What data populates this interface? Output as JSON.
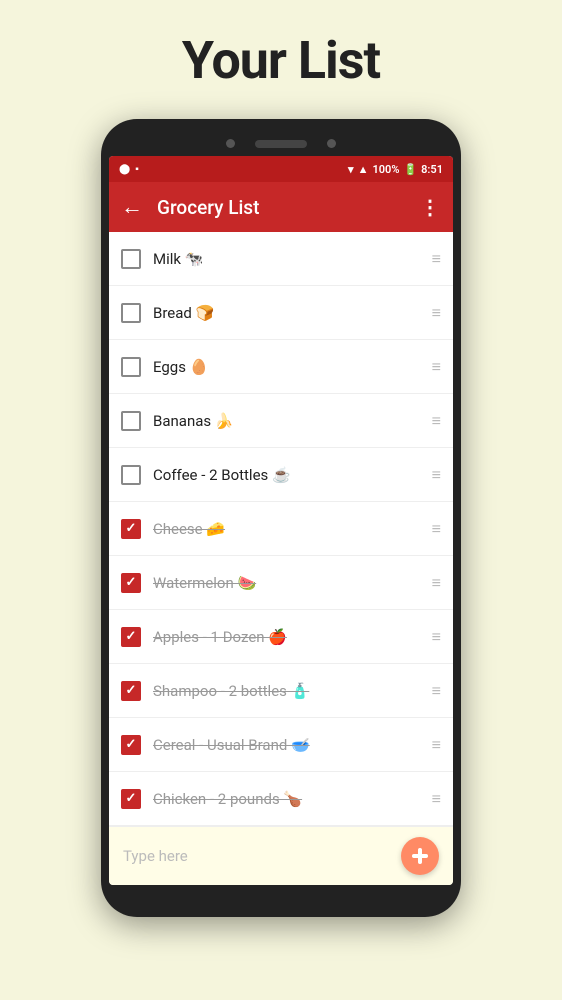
{
  "page": {
    "title": "Your List"
  },
  "statusBar": {
    "battery": "100%",
    "time": "8:51"
  },
  "appBar": {
    "title": "Grocery List",
    "backIcon": "←",
    "menuIcon": "⋮"
  },
  "items": [
    {
      "id": 1,
      "label": "Milk 🐄",
      "checked": false
    },
    {
      "id": 2,
      "label": "Bread 🍞",
      "checked": false
    },
    {
      "id": 3,
      "label": "Eggs 🥚",
      "checked": false
    },
    {
      "id": 4,
      "label": "Bananas 🍌",
      "checked": false
    },
    {
      "id": 5,
      "label": "Coffee - 2 Bottles ☕",
      "checked": false
    },
    {
      "id": 6,
      "label": "Cheese 🧀",
      "checked": true
    },
    {
      "id": 7,
      "label": "Watermelon 🍉",
      "checked": true
    },
    {
      "id": 8,
      "label": "Apples - 1 Dozen 🍎",
      "checked": true
    },
    {
      "id": 9,
      "label": "Shampoo - 2 bottles 🧴",
      "checked": true
    },
    {
      "id": 10,
      "label": "Cereal - Usual Brand 🥣",
      "checked": true
    },
    {
      "id": 11,
      "label": "Chicken - 2 pounds 🍗",
      "checked": true
    }
  ],
  "bottomBar": {
    "placeholder": "Type here"
  }
}
